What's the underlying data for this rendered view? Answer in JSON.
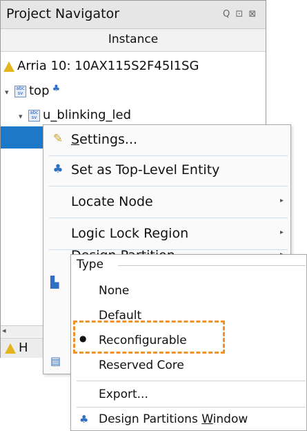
{
  "navigator": {
    "title": "Project Navigator",
    "controls": "Q ⊡ ⊠",
    "column_header": "Instance",
    "device": "Arria 10: 10AX115S2F45I1SG",
    "top_entity": "top",
    "child_instance": "u_blinking_led",
    "sv_icon_text": "abc sv",
    "hierarchy_icon": "hierarchy-icon",
    "device_icon": "warning-triangle-icon",
    "bottom_tab_glyph": "H"
  },
  "context_menu": {
    "items": [
      {
        "label": "Settings...",
        "icon": "pencil-icon",
        "mnemonic": "S",
        "rest": "ettings...",
        "submenu": false
      },
      {
        "label": "Set as Top-Level Entity",
        "icon": "hierarchy-icon",
        "submenu": false
      },
      {
        "label": "Locate Node",
        "icon": "",
        "submenu": true
      },
      {
        "label": "Logic Lock Region",
        "icon": "",
        "submenu": true
      },
      {
        "label": "Design Partition",
        "icon": "",
        "submenu": true
      }
    ]
  },
  "submenu": {
    "group_label": "Type",
    "options": [
      "None",
      "Default",
      "Reconfigurable",
      "Reserved Core"
    ],
    "selected": "Reconfigurable",
    "export_label": "Export...",
    "window_label": "Design Partitions Window",
    "window_label_pre": "Design Partitions ",
    "window_label_mnemonic": "W",
    "window_label_post": "indow"
  },
  "colors": {
    "selection": "#1e78c8",
    "highlight_box": "#f0932b",
    "warning_icon": "#e3b51c",
    "hierarchy_icon": "#2f6fc4"
  }
}
